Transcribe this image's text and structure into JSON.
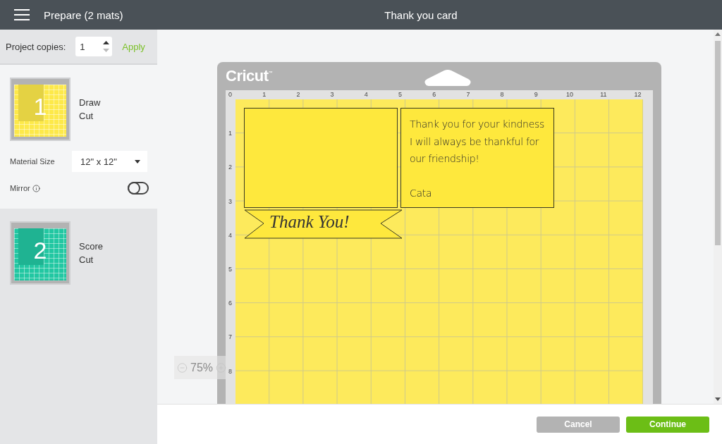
{
  "header": {
    "title": "Prepare (2 mats)",
    "project_title": "Thank you card"
  },
  "copies": {
    "label": "Project copies:",
    "value": "1",
    "apply": "Apply"
  },
  "mats": [
    {
      "number": "1",
      "lines": [
        "Draw",
        "Cut"
      ],
      "selected": true,
      "color": "#fde94a",
      "settings": {
        "material_label": "Material Size",
        "material_value": "12\" x 12\"",
        "mirror_label": "Mirror",
        "mirror_on": false
      }
    },
    {
      "number": "2",
      "lines": [
        "Score",
        "Cut"
      ],
      "selected": false,
      "color": "#22c7a2"
    }
  ],
  "canvas": {
    "logo": "Cricut",
    "logo_mark": "™",
    "top_ruler": [
      "0",
      "1",
      "2",
      "3",
      "4",
      "5",
      "6",
      "7",
      "8",
      "9",
      "10",
      "11",
      "12"
    ],
    "left_ruler": [
      "1",
      "2",
      "3",
      "4",
      "5",
      "6",
      "7",
      "8"
    ],
    "card_lines": [
      "Thank you for your kindness",
      "I will always be thankful for",
      "our friendship!"
    ],
    "signature": "Cata",
    "banner_text": "Thank You!",
    "zoom": "75%"
  },
  "buttons": [
    {
      "label": "Cancel",
      "kind": "secondary"
    },
    {
      "label": "Continue",
      "kind": "primary"
    }
  ]
}
